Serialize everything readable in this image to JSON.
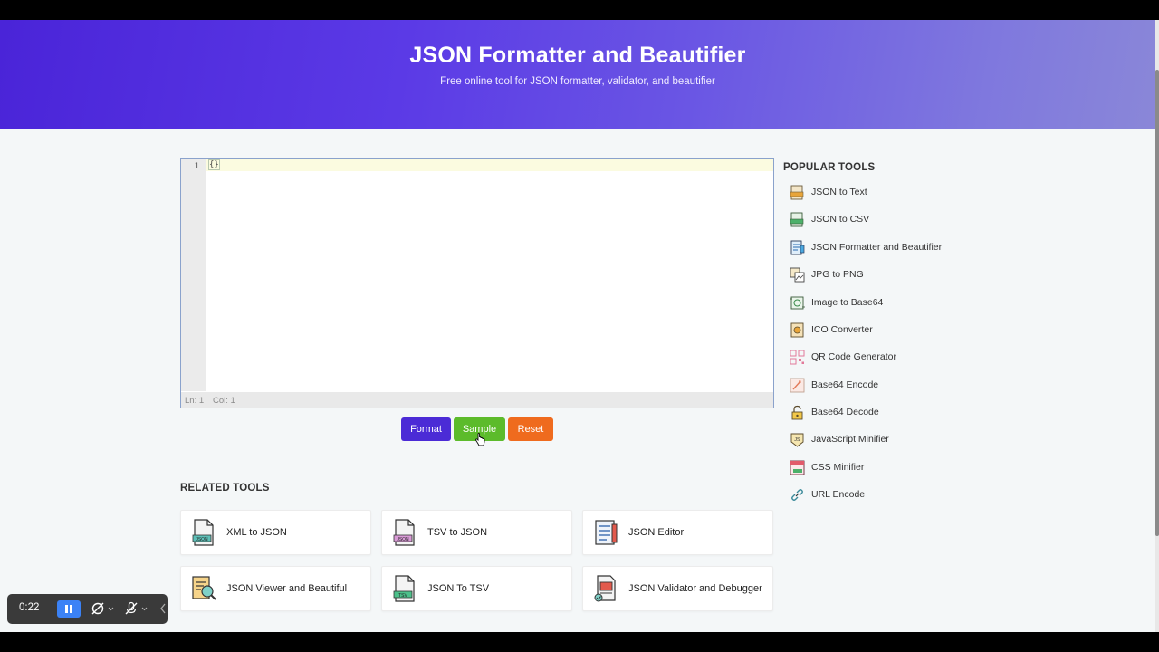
{
  "header": {
    "title": "JSON Formatter and Beautifier",
    "subtitle": "Free online tool for JSON formatter, validator, and beautifier"
  },
  "editor": {
    "line_number": "1",
    "content": "{}",
    "status_line": "Ln: 1",
    "status_col": "Col: 1"
  },
  "actions": {
    "format_label": "Format",
    "sample_label": "Sample",
    "reset_label": "Reset"
  },
  "related_tools": {
    "title": "RELATED TOOLS",
    "items": [
      {
        "label": "XML to JSON",
        "icon": "json-file-icon"
      },
      {
        "label": "TSV to JSON",
        "icon": "json-file-icon"
      },
      {
        "label": "JSON Editor",
        "icon": "document-list-icon"
      },
      {
        "label": "JSON Viewer and Beautiful",
        "icon": "document-search-icon"
      },
      {
        "label": "JSON To TSV",
        "icon": "tsv-file-icon"
      },
      {
        "label": "JSON Validator and Debugger",
        "icon": "document-check-icon"
      }
    ]
  },
  "popular_tools": {
    "title": "POPULAR TOOLS",
    "items": [
      {
        "label": "JSON to Text",
        "icon": "text-file-icon"
      },
      {
        "label": "JSON to CSV",
        "icon": "csv-file-icon"
      },
      {
        "label": "JSON Formatter and Beautifier",
        "icon": "formatter-icon"
      },
      {
        "label": "JPG to PNG",
        "icon": "image-convert-icon"
      },
      {
        "label": "Image to Base64",
        "icon": "image-icon"
      },
      {
        "label": "ICO Converter",
        "icon": "ico-icon"
      },
      {
        "label": "QR Code Generator",
        "icon": "qr-code-icon"
      },
      {
        "label": "Base64 Encode",
        "icon": "encode-icon"
      },
      {
        "label": "Base64 Decode",
        "icon": "unlock-icon"
      },
      {
        "label": "JavaScript Minifier",
        "icon": "js-icon"
      },
      {
        "label": "CSS Minifier",
        "icon": "css-icon"
      },
      {
        "label": "URL Encode",
        "icon": "link-icon"
      }
    ]
  },
  "recorder": {
    "time": "0:22"
  },
  "colors": {
    "brand": "#4b2bd6",
    "sample": "#5cbb2b",
    "reset": "#ef6b1e"
  }
}
